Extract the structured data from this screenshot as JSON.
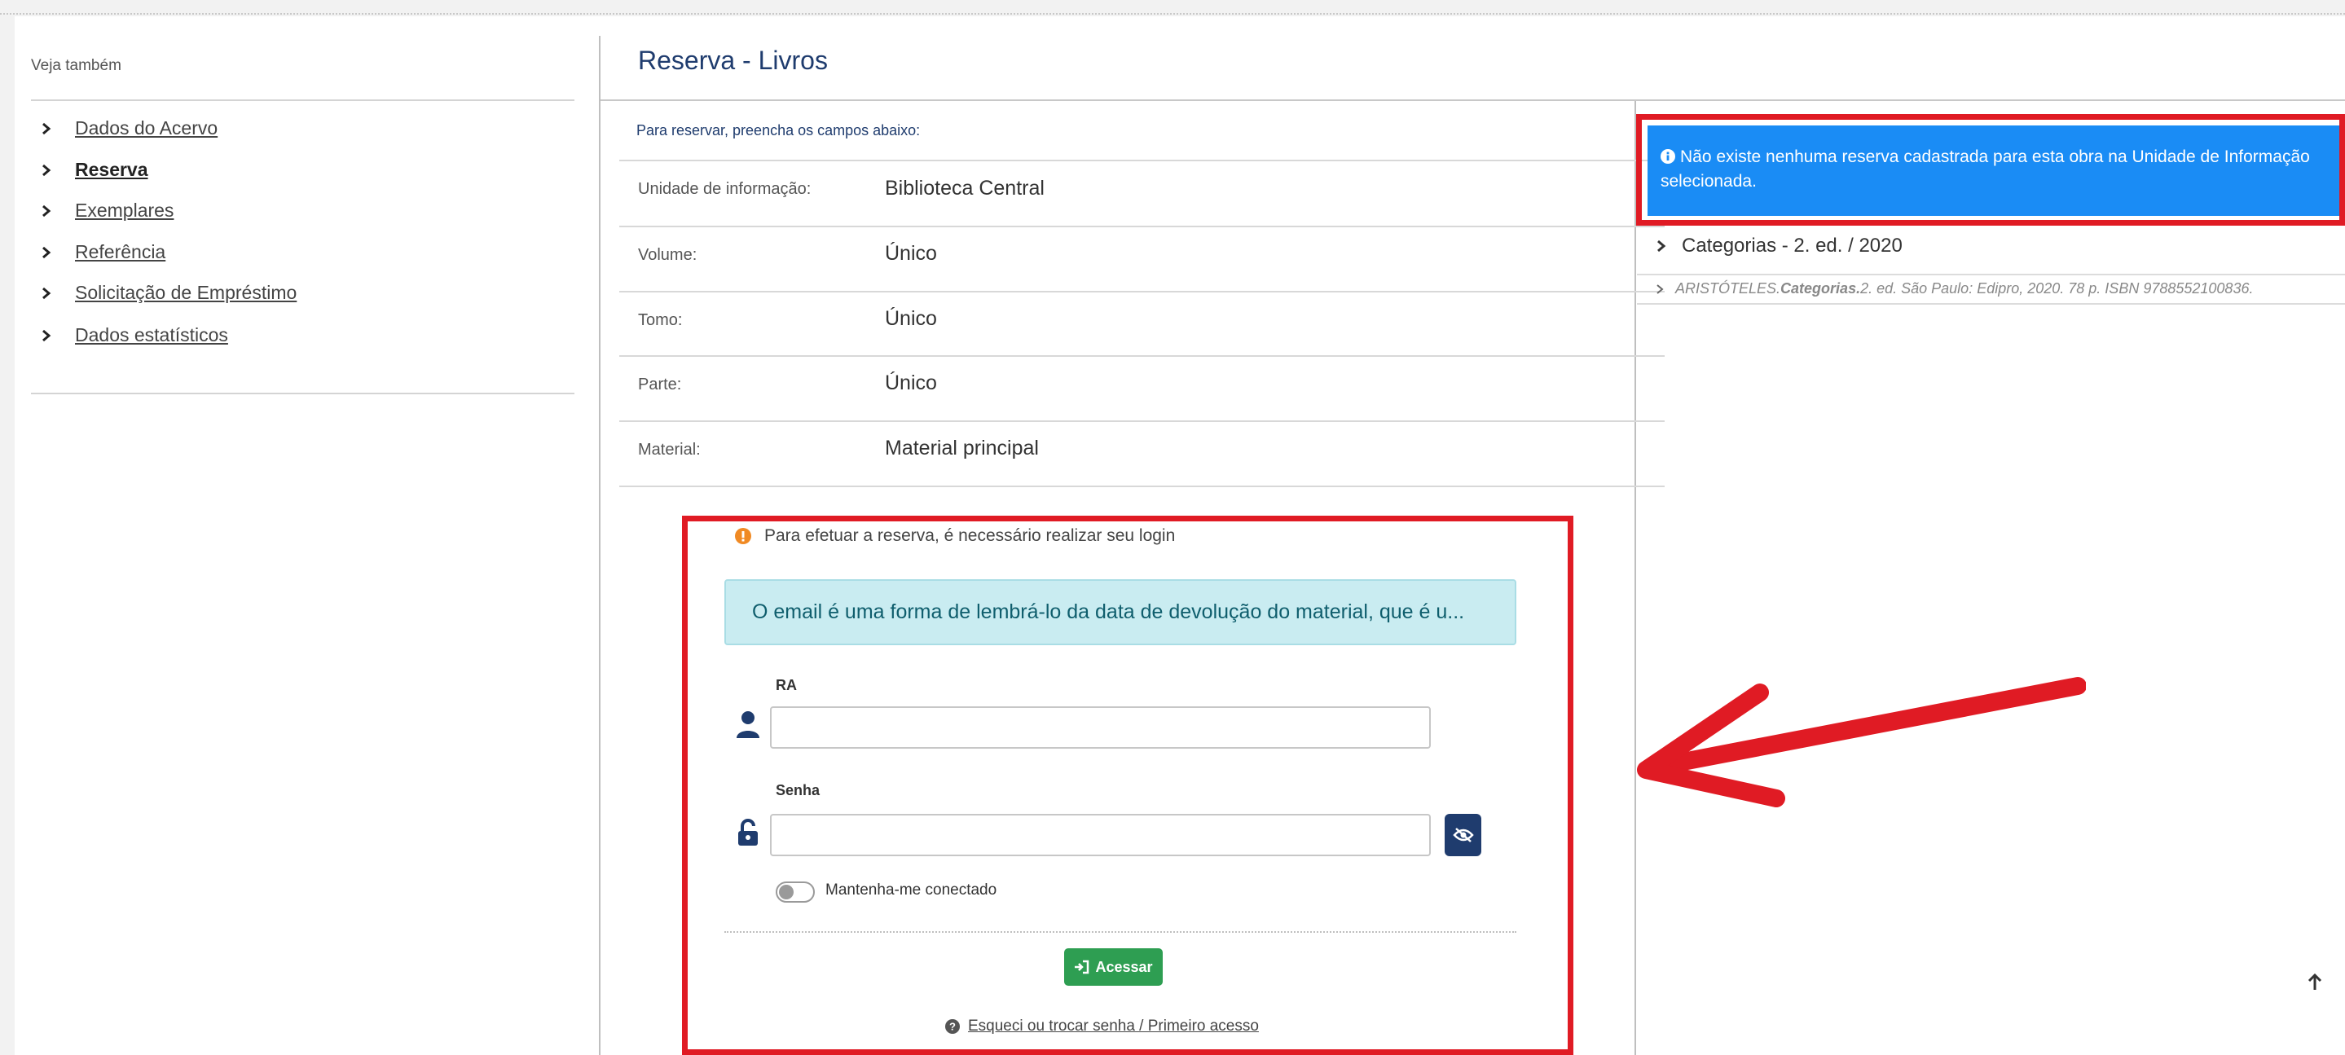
{
  "sidebar": {
    "title": "Veja também",
    "items": [
      {
        "label": "Dados do Acervo"
      },
      {
        "label": "Reserva"
      },
      {
        "label": "Exemplares"
      },
      {
        "label": "Referência"
      },
      {
        "label": "Solicitação de Empréstimo"
      },
      {
        "label": "Dados estatísticos"
      }
    ]
  },
  "main": {
    "title": "Reserva - Livros",
    "intro": "Para reservar, preencha os campos abaixo:",
    "fields": [
      {
        "label": "Unidade de informação:",
        "value": "Biblioteca Central"
      },
      {
        "label": "Volume:",
        "value": "Único"
      },
      {
        "label": "Tomo:",
        "value": "Único"
      },
      {
        "label": "Parte:",
        "value": "Único"
      },
      {
        "label": "Material:",
        "value": "Material principal"
      }
    ]
  },
  "login": {
    "warning": "Para efetuar a reserva, é necessário realizar seu login",
    "info": "O email é uma forma de lembrá-lo da data de devolução do material, que é u...",
    "ra_label": "RA",
    "ra_value": "",
    "senha_label": "Senha",
    "senha_value": "",
    "remember_label": "Mantenha-me conectado",
    "remember_checked": false,
    "submit_label": "Acessar",
    "forgot_label": "Esqueci ou trocar senha / Primeiro acesso"
  },
  "panel": {
    "alert": "Não existe nenhuma reserva cadastrada para esta obra na Unidade de Informação selecionada.",
    "category": "Categorias - 2. ed. / 2020",
    "reference_author": "ARISTÓTELES. ",
    "reference_title": "Categorias.",
    "reference_rest": " 2. ed. São Paulo: Edipro, 2020. 78 p. ISBN 9788552100836."
  },
  "colors": {
    "brand_navy": "#1f3c6e",
    "alert_blue": "#1a8cf5",
    "success_green": "#2e9e52",
    "annotation_red": "#e01b24",
    "info_bg": "#c9ecf1"
  },
  "icons": [
    "chevron-right-icon",
    "warning-icon",
    "user-icon",
    "unlock-icon",
    "eye-slash-icon",
    "sign-in-icon",
    "question-icon",
    "info-icon",
    "arrow-up-icon",
    "annotation-arrow"
  ]
}
